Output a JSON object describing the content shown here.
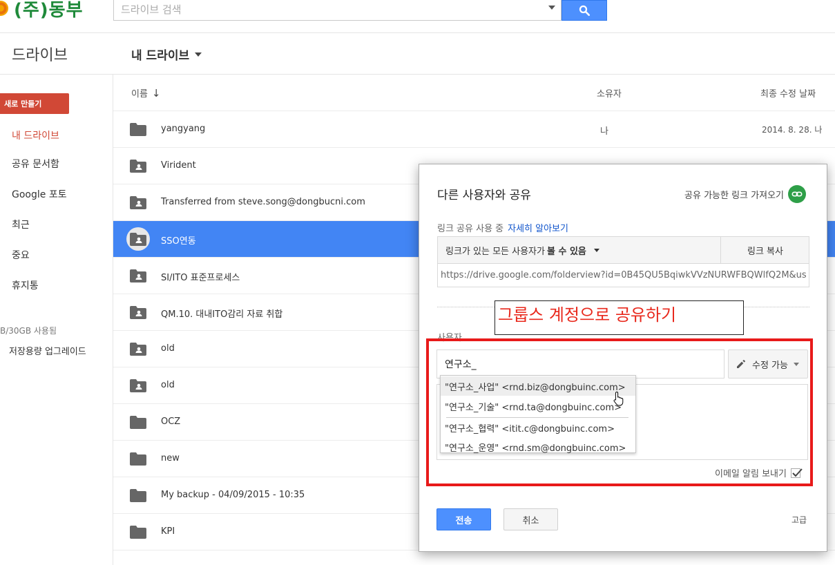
{
  "header": {
    "logo_text": "(주)동부",
    "search_placeholder": "드라이브 검색"
  },
  "subheader": {
    "app_title": "드라이브",
    "breadcrumb": "내 드라이브"
  },
  "sidebar": {
    "new_button": "새로 만들기",
    "items": [
      {
        "label": "내 드라이브",
        "active": true
      },
      {
        "label": "공유 문서함"
      },
      {
        "label": "Google 포토"
      },
      {
        "label": "최근"
      },
      {
        "label": "중요"
      },
      {
        "label": "휴지통"
      }
    ],
    "storage": "B/30GB 사용됨",
    "upgrade": "저장용량 업그레이드"
  },
  "list": {
    "columns": {
      "name": "이름",
      "owner": "소유자",
      "modified": "최종 수정 날짜"
    },
    "rows": [
      {
        "name": "yangyang",
        "owner": "나",
        "modified": "2014. 8. 28. 나",
        "shared": false
      },
      {
        "name": "Virident",
        "owner": "",
        "modified": "",
        "shared": true
      },
      {
        "name": "Transferred from steve.song@dongbucni.com",
        "owner": "",
        "modified": "",
        "shared": true
      },
      {
        "name": "SSO연동",
        "owner": "",
        "modified": "",
        "shared": true,
        "selected": true
      },
      {
        "name": "SI/ITO 표준프로세스",
        "owner": "",
        "modified": "",
        "shared": true
      },
      {
        "name": "QM.10. 대내ITO감리 자료 취합",
        "owner": "",
        "modified": "",
        "shared": true
      },
      {
        "name": "old",
        "owner": "",
        "modified": "",
        "shared": true
      },
      {
        "name": "old",
        "owner": "",
        "modified": "",
        "shared": true
      },
      {
        "name": "OCZ",
        "owner": "",
        "modified": "",
        "shared": false
      },
      {
        "name": "new",
        "owner": "",
        "modified": "",
        "shared": false
      },
      {
        "name": "My backup - 04/09/2015 - 10:35",
        "owner": "",
        "modified": "",
        "shared": false
      },
      {
        "name": "KPI",
        "owner": "",
        "modified": "",
        "shared": false
      }
    ]
  },
  "dialog": {
    "title": "다른 사용자와 공유",
    "get_link": "공유 가능한 링크 가져오기",
    "link_status": "링크 공유 사용 중",
    "learn_more": "자세히 알아보기",
    "access_prefix": "링크가 있는 모든 사용자가",
    "access_bold": "볼 수 있음",
    "copy_link": "링크 복사",
    "url": "https://drive.google.com/folderview?id=0B45QU5BqiwkVVzNURWFBQWlfQ2M&usp",
    "users_label": "사용자",
    "people_input": "연구소_",
    "permission": "수정 가능",
    "suggestions": [
      "\"연구소_사업\" <rnd.biz@dongbuinc.com>",
      "\"연구소_기술\" <rnd.ta@dongbuinc.com>",
      "\"연구소_협력\" <itit.c@dongbuinc.com>",
      "\"연구소_운영\" <rnd.sm@dongbuinc.com>"
    ],
    "notify_label": "이메일 알림 보내기",
    "notify_checked": true,
    "send": "전송",
    "cancel": "취소",
    "advanced": "고급"
  },
  "annotation": {
    "text": "그룹스 계정으로 공유하기",
    "color": "#e8281c"
  },
  "colors": {
    "accent": "#4285f4",
    "new_button": "#d14836",
    "annotation_frame": "#e81a1a"
  }
}
